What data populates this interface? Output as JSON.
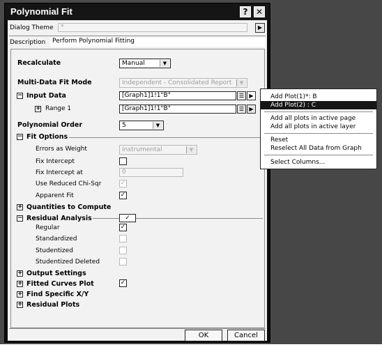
{
  "window": {
    "title": "Polynomial Fit",
    "help_label": "?",
    "close_label": "✕"
  },
  "header": {
    "theme_label": "Dialog Theme",
    "theme_value": "*",
    "theme_arrow": "▶",
    "description_label": "Description",
    "description_value": "Perform Polynomial Fitting"
  },
  "form": {
    "recalculate_label": "Recalculate",
    "recalculate_value": "Manual",
    "mode_label": "Multi-Data Fit Mode",
    "mode_value": "Independent - Consolidated Report",
    "input_data_label": "Input Data",
    "input_data_value": "[Graph1]1!1\"B\"",
    "range_label": "Range 1",
    "range_value": "[Graph1]1!1\"B\"",
    "order_label": "Polynomial Order",
    "order_value": "5",
    "fit_options_label": "Fit Options",
    "errors_label": "Errors as Weight",
    "errors_value": "Instrumental",
    "fix_intercept_label": "Fix Intercept",
    "fix_intercept_at_label": "Fix Intercept at",
    "fix_intercept_at_value": "0",
    "reduced_chi_label": "Use Reduced Chi-Sqr",
    "apparent_fit_label": "Apparent Fit",
    "quantities_label": "Quantities to Compute",
    "residual_label": "Residual Analysis",
    "regular_label": "Regular",
    "standardized_label": "Standardized",
    "studentized_label": "Studentized",
    "studentized_deleted_label": "Studentized Deleted",
    "output_settings_label": "Output Settings",
    "fitted_curves_label": "Fitted Curves Plot",
    "find_xy_label": "Find Specific X/Y",
    "residual_plots_label": "Residual Plots"
  },
  "buttons": {
    "ok": "OK",
    "cancel": "Cancel"
  },
  "context_menu": {
    "items": [
      "Add Plot(1)*: B",
      "Add Plot(2) : C",
      "Add all plots in active page",
      "Add all plots in active layer",
      "Reset",
      "Reselect All Data from Graph",
      "Select Columns..."
    ],
    "selected_index": 1
  },
  "glyphs": {
    "check": "✓",
    "plus": "+",
    "minus": "−",
    "arrow_right": "▶",
    "arrow_down": "▼"
  },
  "colors": {
    "titlebar": "#151515",
    "panel": "#f2f2f2",
    "selection": "#161616"
  }
}
